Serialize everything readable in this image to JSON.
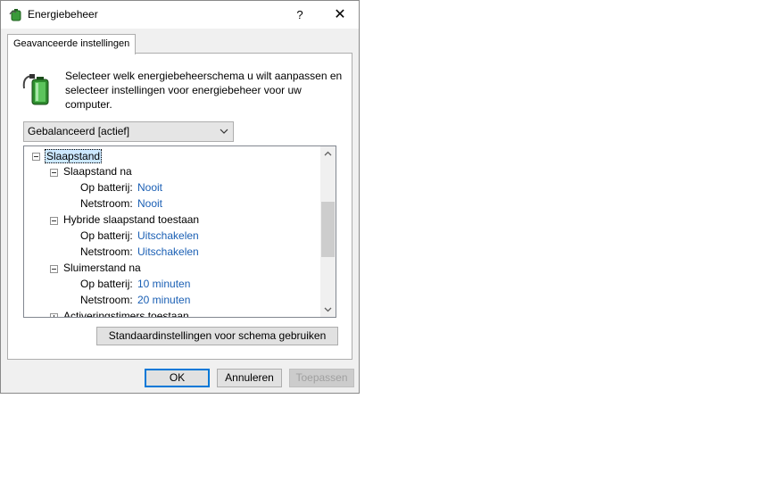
{
  "window": {
    "title": "Energiebeheer",
    "help_label": "?",
    "close_label": "✕"
  },
  "tab": {
    "label": "Geavanceerde instellingen"
  },
  "description": {
    "line1": "Selecteer welk energiebeheerschema u wilt aanpassen en",
    "line2": "selecteer instellingen voor energiebeheer voor uw",
    "line3": "computer."
  },
  "scheme_select": {
    "value": "Gebalanceerd [actief]"
  },
  "tree": {
    "root": "Slaapstand",
    "groups": [
      {
        "label": "Slaapstand na",
        "battery_label": "Op batterij:",
        "battery_value": "Nooit",
        "ac_label": "Netstroom:",
        "ac_value": "Nooit"
      },
      {
        "label": "Hybride slaapstand toestaan",
        "battery_label": "Op batterij:",
        "battery_value": "Uitschakelen",
        "ac_label": "Netstroom:",
        "ac_value": "Uitschakelen"
      },
      {
        "label": "Sluimerstand na",
        "battery_label": "Op batterij:",
        "battery_value": "10 minuten",
        "ac_label": "Netstroom:",
        "ac_value": "20 minuten"
      }
    ],
    "next_item": "Activeringstimers toestaan"
  },
  "buttons": {
    "restore_defaults": "Standaardinstellingen voor schema gebruiken",
    "ok": "OK",
    "cancel": "Annuleren",
    "apply": "Toepassen"
  },
  "colors": {
    "link": "#1a5fb4",
    "selection": "#cce8ff",
    "accent": "#0078d7"
  }
}
